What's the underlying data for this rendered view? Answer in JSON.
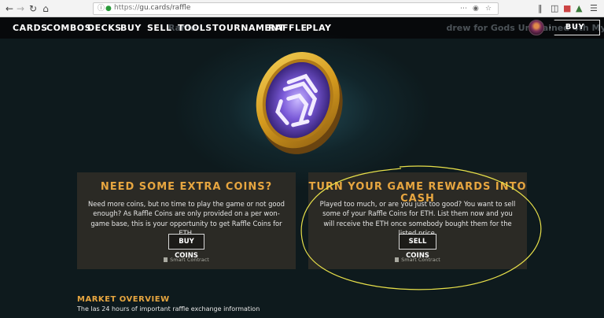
{
  "browser": {
    "url_scheme": "https://",
    "url_host": "gu.cards/raffle"
  },
  "nav": {
    "items": [
      "CARDS",
      "COMBOS",
      "DECKS",
      "BUY",
      "SELL",
      "TOOLS",
      "TOURNAMENT",
      "RAFFLE",
      "PLAY"
    ],
    "buy_packs": "BUY PACKS"
  },
  "panels": {
    "left": {
      "title": "NEED SOME EXTRA COINS?",
      "body": "Need more coins, but no time to play the game or not good enough? As Raffle Coins are only provided on a per won-game base, this is your opportunity to get Raffle Coins for ETH.",
      "button": "BUY COINS",
      "contract": "Smart Contract"
    },
    "right": {
      "title": "TURN YOUR GAME REWARDS INTO CASH",
      "body": "Played too much, or are you just too good? You want to sell some of your Raffle Coins for ETH. List them now and you will receive the ETH once somebody bought them for the listed price.",
      "button": "SELL COINS",
      "contract": "Smart Contract"
    }
  },
  "market": {
    "title": "MARKET OVERVIEW",
    "subtitle": "The las 24 hours of important raffle exchange information"
  },
  "colors": {
    "accent": "#e7a640",
    "panel_bg": "#2b2a25",
    "page_bg": "#0e1a1d",
    "nav_bg": "#07090b",
    "annotation": "#e8e04a"
  }
}
